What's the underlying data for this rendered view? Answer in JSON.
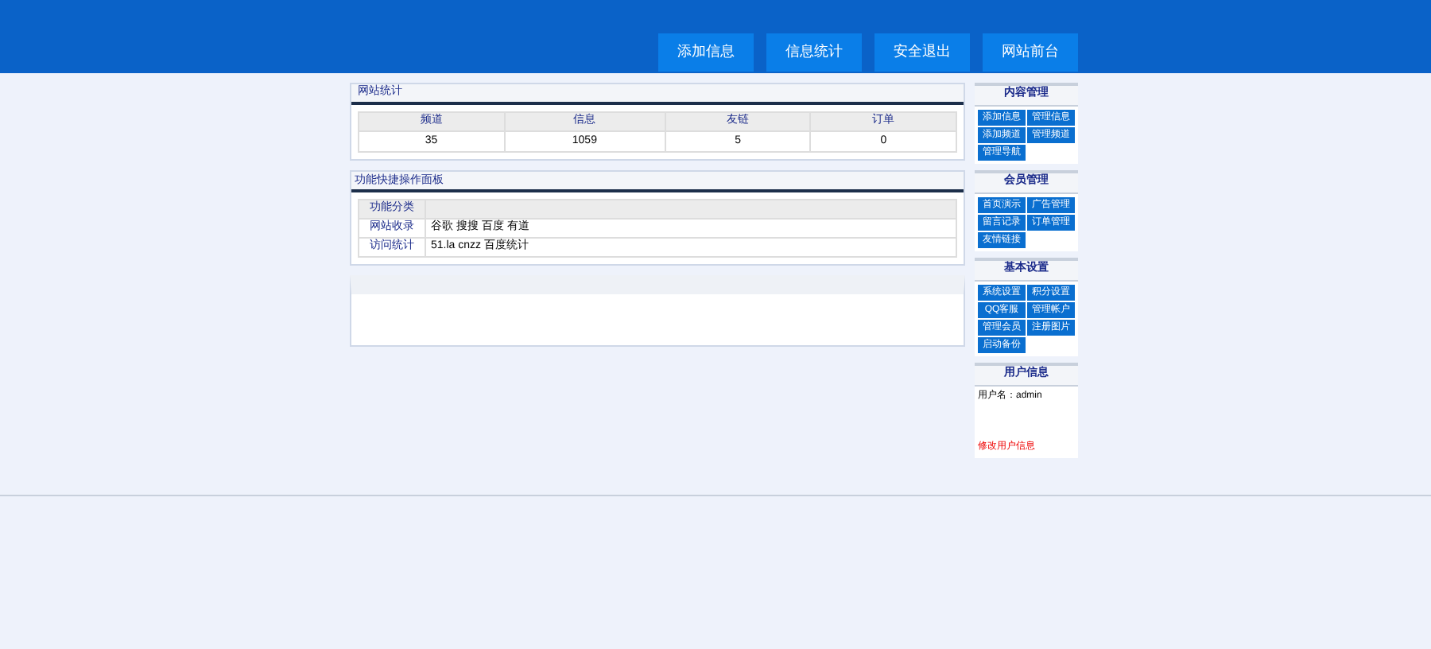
{
  "header": {
    "buttons": [
      "添加信息",
      "信息统计",
      "安全退出",
      "网站前台"
    ]
  },
  "stats": {
    "title": "网站统计",
    "columns": [
      "频道",
      "信息",
      "友链",
      "订单"
    ],
    "values": [
      "35",
      "1059",
      "5",
      "0"
    ]
  },
  "quick": {
    "title": "功能快捷操作面板",
    "rows": [
      {
        "label": "功能分类",
        "value": ""
      },
      {
        "label": "网站收录",
        "value": "谷歌 搜搜 百度 有道"
      },
      {
        "label": "访问统计",
        "value": "51.la cnzz 百度统计"
      }
    ]
  },
  "sidebar": [
    {
      "title": "内容管理",
      "items": [
        "添加信息",
        "管理信息",
        "添加频道",
        "管理频道",
        "管理导航"
      ]
    },
    {
      "title": "会员管理",
      "items": [
        "首页演示",
        "广告管理",
        "留言记录",
        "订单管理",
        "友情链接"
      ]
    },
    {
      "title": "基本设置",
      "items": [
        "系统设置",
        "积分设置",
        "QQ客服",
        "管理帐户",
        "管理会员",
        "注册图片",
        "启动备份"
      ]
    }
  ],
  "user": {
    "title": "用户信息",
    "username": "用户名：admin",
    "link": "修改用户信息"
  }
}
